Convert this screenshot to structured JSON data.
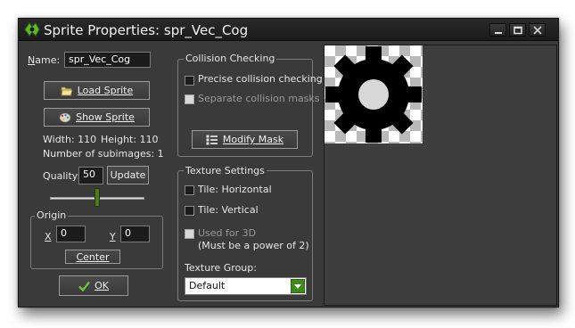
{
  "window": {
    "title": "Sprite Properties: spr_Vec_Cog",
    "controls": [
      "minimize-icon",
      "maximize-icon",
      "close-icon"
    ]
  },
  "left": {
    "name_label": "Name:",
    "name_value": "spr_Vec_Cog",
    "load_sprite": "Load Sprite",
    "show_sprite": "Show Sprite",
    "width_text": "Width: 110",
    "height_text": "Height: 110",
    "subimages_text": "Number of subimages: 1",
    "quality_label": "Quality:",
    "quality_value": "50",
    "update_label": "Update",
    "quality_fraction": 0.5,
    "origin": {
      "legend": "Origin",
      "x_label": "X",
      "x_value": "0",
      "y_label": "Y",
      "y_value": "0",
      "center_label": "Center"
    },
    "ok_label": "OK"
  },
  "collision": {
    "legend": "Collision Checking",
    "precise_label": "Precise collision checking",
    "precise_checked": false,
    "separate_label": "Separate collision masks",
    "separate_enabled": false,
    "modify_mask": "Modify Mask"
  },
  "texture": {
    "legend": "Texture Settings",
    "tile_h": "Tile: Horizontal",
    "tile_v": "Tile: Vertical",
    "used3d_line1": "Used for 3D",
    "used3d_line2": "(Must be a power of 2)",
    "group_label": "Texture Group:",
    "group_value": "Default"
  },
  "colors": {
    "window_bg": "#3a3a3a",
    "accent_green": "#3f8a1e",
    "preview_bg": "#3e3e3e"
  },
  "preview": {
    "icon": "cog-icon"
  }
}
